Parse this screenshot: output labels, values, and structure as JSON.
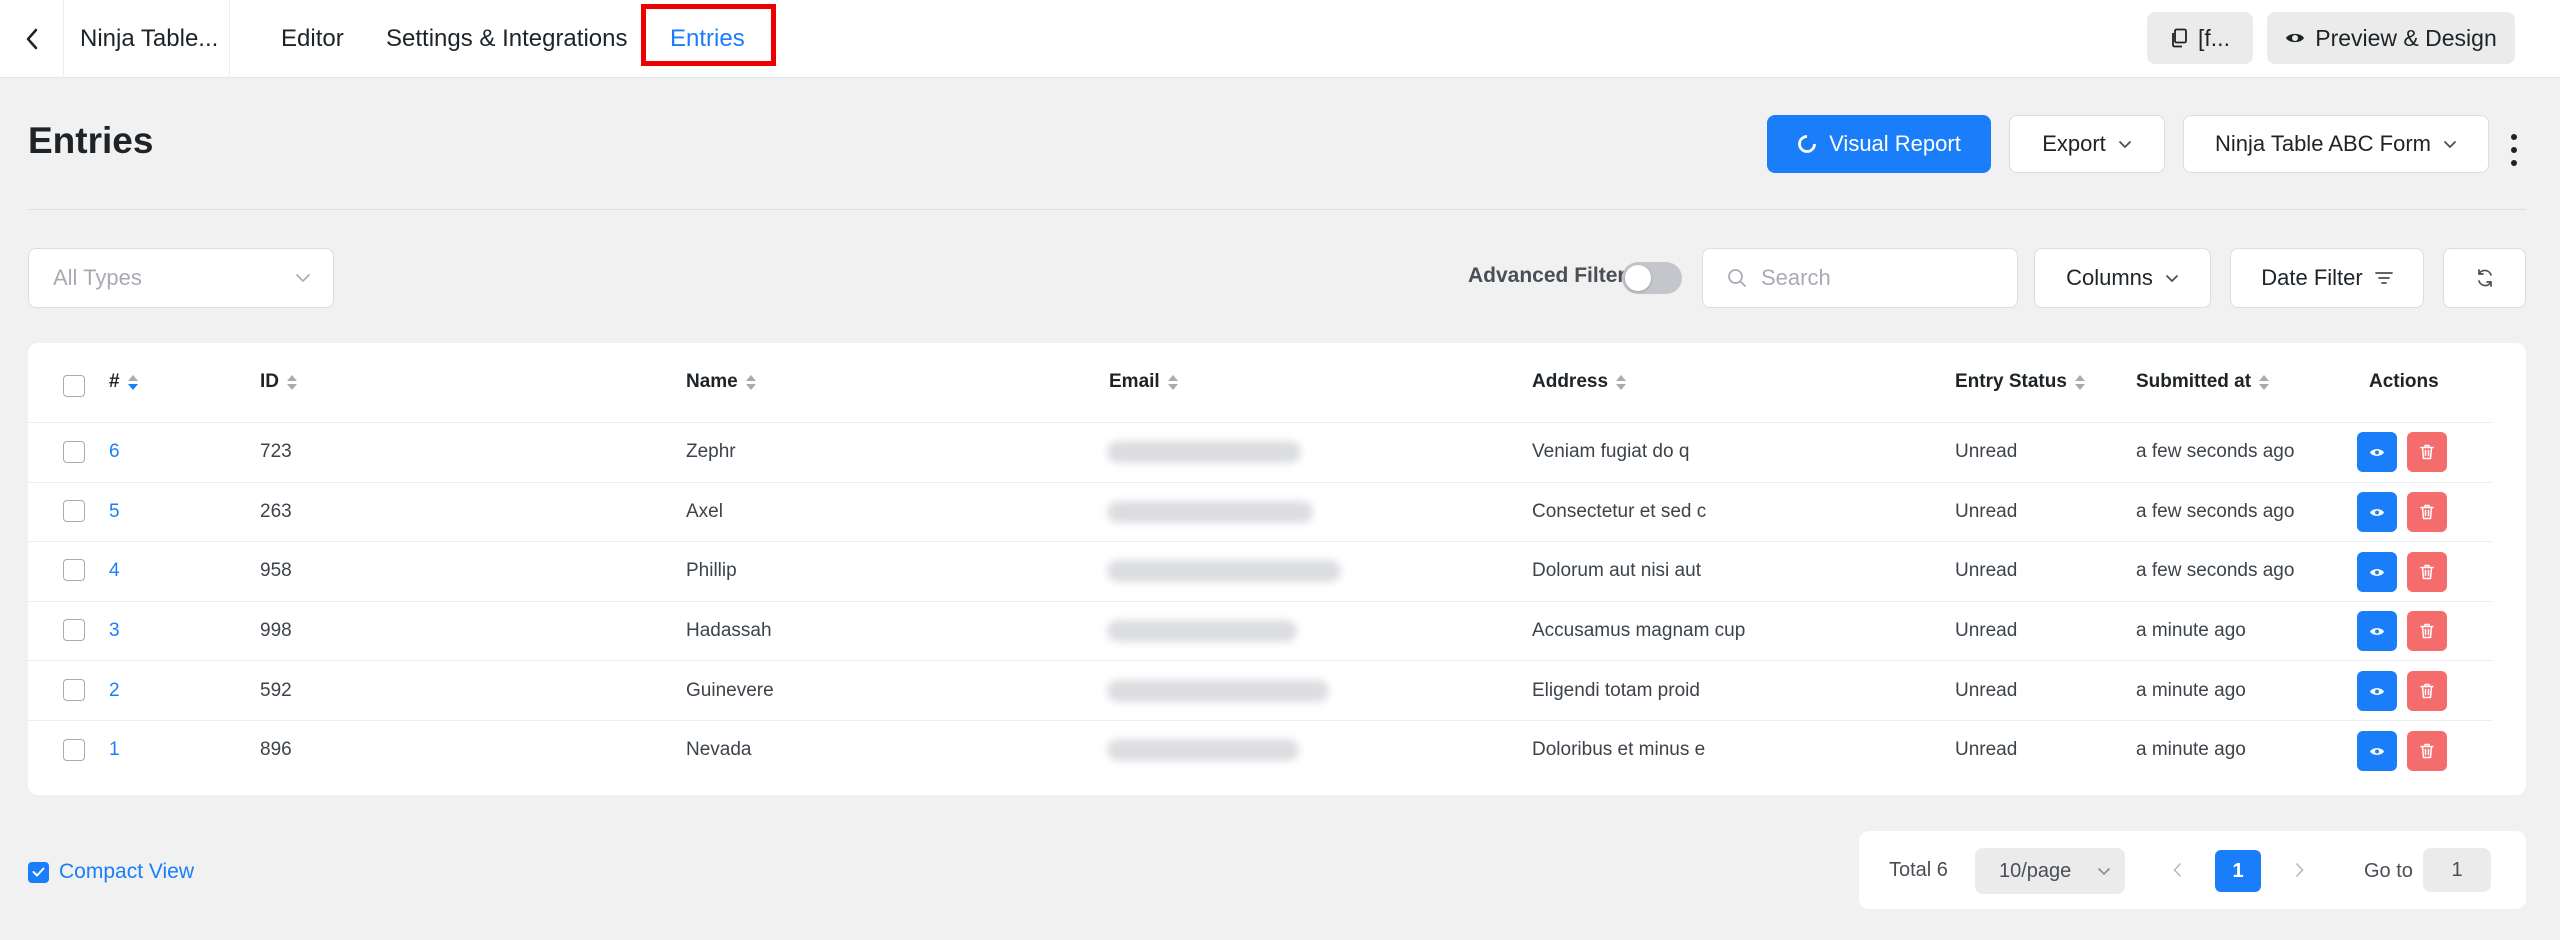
{
  "topbar": {
    "form_title": "Ninja Table...",
    "tabs": [
      {
        "label": "Editor"
      },
      {
        "label": "Settings & Integrations"
      },
      {
        "label": "Entries",
        "active": true
      }
    ],
    "shortcode_label": "[f...",
    "preview_label": "Preview & Design"
  },
  "header": {
    "title": "Entries",
    "visual_report_label": "Visual Report",
    "export_label": "Export",
    "form_select_label": "Ninja Table ABC Form"
  },
  "filters": {
    "types_placeholder": "All Types",
    "advanced_filter_label": "Advanced Filter",
    "advanced_filter_on": false,
    "search_placeholder": "Search",
    "columns_label": "Columns",
    "date_filter_label": "Date Filter"
  },
  "table": {
    "headers": {
      "serial": "#",
      "id": "ID",
      "name": "Name",
      "email": "Email",
      "address": "Address",
      "status": "Entry Status",
      "submitted": "Submitted at",
      "actions": "Actions"
    },
    "rows": [
      {
        "serial": "6",
        "id": "723",
        "name": "Zephr",
        "address": "Veniam fugiat do q",
        "status": "Unread",
        "submitted": "a few seconds ago"
      },
      {
        "serial": "5",
        "id": "263",
        "name": "Axel",
        "address": "Consectetur et sed c",
        "status": "Unread",
        "submitted": "a few seconds ago"
      },
      {
        "serial": "4",
        "id": "958",
        "name": "Phillip",
        "address": "Dolorum aut nisi aut",
        "status": "Unread",
        "submitted": "a few seconds ago"
      },
      {
        "serial": "3",
        "id": "998",
        "name": "Hadassah",
        "address": "Accusamus magnam cup",
        "status": "Unread",
        "submitted": "a minute ago"
      },
      {
        "serial": "2",
        "id": "592",
        "name": "Guinevere",
        "address": "Eligendi totam proid",
        "status": "Unread",
        "submitted": "a minute ago"
      },
      {
        "serial": "1",
        "id": "896",
        "name": "Nevada",
        "address": "Doloribus et minus e",
        "status": "Unread",
        "submitted": "a minute ago"
      }
    ]
  },
  "footer": {
    "compact_view_label": "Compact View",
    "compact_view_checked": true,
    "total_label": "Total 6",
    "page_size_label": "10/page",
    "current_page": "1",
    "goto_label": "Go to",
    "goto_value": "1"
  },
  "colors": {
    "primary": "#1a7efb",
    "danger": "#f56c6c",
    "highlight": "#ee0000"
  }
}
